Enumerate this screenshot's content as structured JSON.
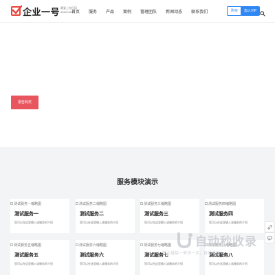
{
  "header": {
    "logo_text": "企业一号",
    "tagline_line1": "最爱上你打码",
    "tagline_line2": "88881188",
    "nav": [
      "首页",
      "服务",
      "产品",
      "案例",
      "管理团队",
      "新闻动态",
      "联系我们"
    ],
    "login_label": "购买",
    "vip_label": "加入VIP"
  },
  "hero": {
    "button_label": "报告有奖"
  },
  "services": {
    "title": "服务模块演示",
    "cards": [
      {
        "img_alt": "测试服务一缩略图",
        "title": "测试服务一",
        "desc": "您可以在这里输入该服务的介绍"
      },
      {
        "img_alt": "测试服务二缩略图",
        "title": "测试服务二",
        "desc": "您可以在这里输入该服务的介绍"
      },
      {
        "img_alt": "测试服务三缩略图",
        "title": "测试服务三",
        "desc": "您可以在这里输入该服务的介绍"
      },
      {
        "img_alt": "测试服务四缩略图",
        "title": "测试服务四",
        "desc": "您可以在这里输入该服务的介绍"
      },
      {
        "img_alt": "测试服务五缩略图",
        "title": "测试服务五",
        "desc": "您可以在这里输入该服务的介绍"
      },
      {
        "img_alt": "测试服务六缩略图",
        "title": "测试服务六",
        "desc": "您可以在这里输入该服务的介绍"
      },
      {
        "img_alt": "测试服务七缩略图",
        "title": "测试服务七",
        "desc": "您可以在这里输入该服务的介绍"
      },
      {
        "img_alt": "测试服务八缩略图",
        "title": "测试服务八",
        "desc": "您可以在这里输入该服务的介绍"
      }
    ]
  },
  "watermark": {
    "text": "自动秒收录",
    "subtext": "做上链接一来访一次，自动收录一"
  },
  "colors": {
    "brand_red": "#e8443a",
    "accent_blue": "#2f87f6",
    "hero_button": "#e8555f",
    "section_bg": "#f3f4f6"
  },
  "icons": {
    "logo": "checkbox-logo-icon",
    "search": "search-icon",
    "side_tool_1": "link-icon",
    "side_tool_2": "chat-icon"
  }
}
